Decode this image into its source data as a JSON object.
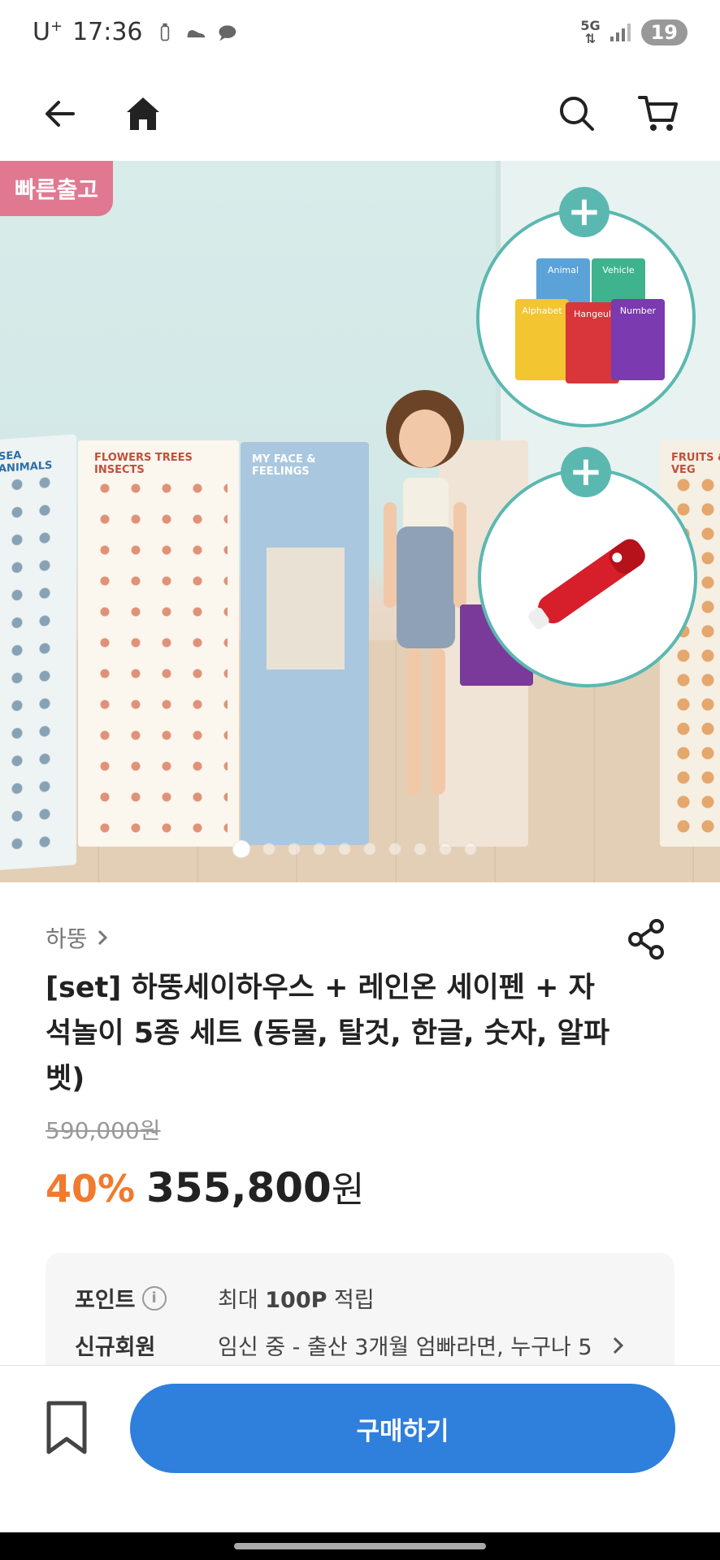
{
  "status": {
    "carrier": "U",
    "carrier_sup": "+",
    "time": "17:36",
    "network": "5G",
    "battery": "19"
  },
  "icons": {
    "back": "back-arrow-icon",
    "home": "home-icon",
    "search": "search-icon",
    "cart": "cart-icon",
    "share": "share-icon",
    "bookmark": "bookmark-icon",
    "info": "info-icon",
    "chevron": "chevron-right-icon"
  },
  "hero": {
    "badge": "빠른출고",
    "posters": [
      "SEA ANIMALS",
      "FLOWERS TREES INSECTS",
      "MY FACE & FEELINGS",
      "FRUITS & VEG"
    ],
    "books": [
      "Animal",
      "Vehicle",
      "Alphabet",
      "Hangeul",
      "Number"
    ],
    "slide_count": 10,
    "active_slide": 1
  },
  "product": {
    "brand": "하뚱",
    "title": "[set] 하뚱세이하우스 + 레인온 세이펜 + 자석놀이 5종 세트 (동물, 탈것, 한글, 숫자, 알파벳)",
    "original_price": "590,000원",
    "discount": "40%",
    "price": "355,800",
    "currency": "원"
  },
  "benefits": [
    {
      "label": "포인트",
      "value_prefix": "최대 ",
      "value_bold": "100P",
      "value_suffix": " 적립"
    },
    {
      "label": "신규회원",
      "value": "임신 중 - 출산 3개월 엄빠라면, 누구나 5"
    }
  ],
  "bottom": {
    "buy_label": "구매하기"
  },
  "colors": {
    "accent_blue": "#2f7fdc",
    "discount_orange": "#f07a2e",
    "badge_pink": "#e07891",
    "teal": "#5bb8b0"
  }
}
